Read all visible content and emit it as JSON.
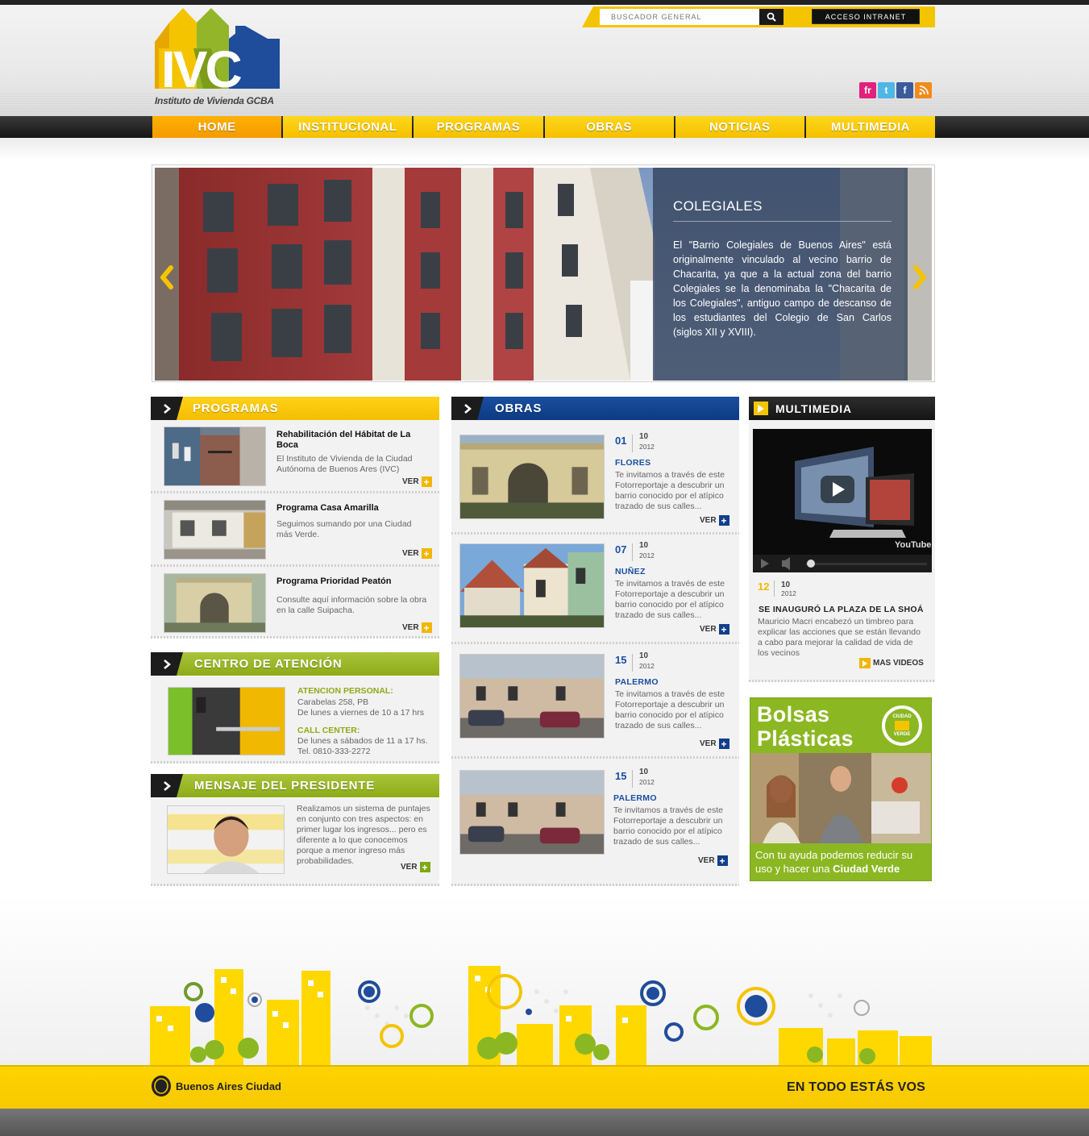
{
  "header": {
    "logo_subtitle": "Instituto de Vivienda GCBA",
    "search_placeholder": "BUSCADOR GENERAL",
    "intranet_label": "ACCESO INTRANET",
    "social": [
      "fr",
      "t",
      "f",
      "rss"
    ]
  },
  "nav": {
    "items": [
      "HOME",
      "INSTITUCIONAL",
      "PROGRAMAS",
      "OBRAS",
      "NOTICIAS",
      "MULTIMEDIA"
    ],
    "active": "HOME"
  },
  "slider": {
    "title": "COLEGIALES",
    "text": "El \"Barrio Colegiales de Buenos Aires\" está originalmente vinculado al vecino barrio de Chacarita, ya que a la actual zona del barrio Colegiales se la denominaba la \"Chacarita de los Colegiales\", antiguo campo de descanso de los estudiantes del Colegio de San Carlos (siglos XII y XVIII)."
  },
  "programas": {
    "heading": "PROGRAMAS",
    "ver_label": "VER",
    "items": [
      {
        "title": "Rehabilitación del Hábitat de La Boca",
        "desc": "El Instituto de Vivienda de la Ciudad Autónoma de Buenos Ares (IVC)"
      },
      {
        "title": "Programa Casa Amarilla",
        "desc": "Seguimos sumando por una Ciudad más Verde."
      },
      {
        "title": "Programa Prioridad Peatón",
        "desc": "Consulte aquí información sobre la obra en la calle Suipacha."
      }
    ]
  },
  "centro": {
    "heading": "CENTRO DE ATENCIÓN",
    "personal_label": "ATENCION PERSONAL:",
    "personal_address": "Carabelas 258, PB",
    "personal_hours": "De lunes a viernes de 10 a 17 hrs",
    "call_label": "CALL CENTER:",
    "call_hours": "De lunes a sábados de 11 a 17 hs.",
    "call_phone": "Tel. 0810-333-2272"
  },
  "presidente": {
    "heading": "MENSAJE DEL PRESIDENTE",
    "text": "Realizamos un sistema de puntajes en conjunto con tres aspectos: en primer lugar los ingresos... pero es diferente a lo que conocemos porque a menor ingreso más probabilidades.",
    "ver_label": "VER"
  },
  "obras": {
    "heading": "OBRAS",
    "ver_label": "VER",
    "items": [
      {
        "day": "01",
        "month": "10",
        "year": "2012",
        "barrio": "FLORES",
        "desc": "Te invitamos a través de este Fotorreportaje a descubrir un barrio conocido por el atípico trazado de sus calles..."
      },
      {
        "day": "07",
        "month": "10",
        "year": "2012",
        "barrio": "NUÑEZ",
        "desc": "Te invitamos a través de este Fotorreportaje a descubrir un barrio conocido por el atípico trazado de sus calles..."
      },
      {
        "day": "15",
        "month": "10",
        "year": "2012",
        "barrio": "PALERMO",
        "desc": "Te invitamos a través de este Fotorreportaje a descubrir un barrio conocido por el atípico trazado de sus calles..."
      },
      {
        "day": "15",
        "month": "10",
        "year": "2012",
        "barrio": "PALERMO",
        "desc": "Te invitamos a través de este Fotorreportaje a descubrir un barrio conocido por el atípico trazado de sus calles..."
      }
    ]
  },
  "multimedia": {
    "heading": "MULTIMEDIA",
    "video_brand": "YouTube",
    "day": "12",
    "month": "10",
    "year": "2012",
    "title": "SE INAUGURÓ LA PLAZA DE LA SHOÁ",
    "desc": "Mauricio Macri encabezó un timbreo para explicar las acciones que se están llevando a cabo para mejorar la calidad de vida de los vecinos",
    "more_label": "MAS VIDEOS"
  },
  "bolsas": {
    "title_line1": "Bolsas",
    "title_line2": "Plásticas",
    "badge_top": "CIUDAD",
    "badge_bottom": "VERDE",
    "text": "Con tu ayuda podemos reducir su uso y hacer una ",
    "text_bold": "Ciudad Verde"
  },
  "footer": {
    "city": "Buenos Aires Ciudad",
    "slogan": "EN TODO ESTÁS VOS"
  },
  "colors": {
    "brand_yellow": "#f5c400",
    "brand_blue": "#0d3a82",
    "brand_green": "#8dab17",
    "active_orange": "#f59b00"
  }
}
